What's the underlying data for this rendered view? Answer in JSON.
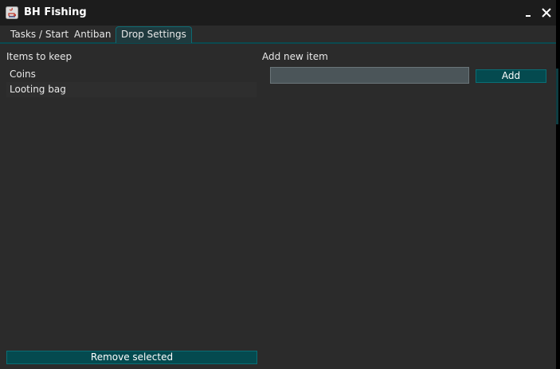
{
  "window": {
    "title": "BH Fishing",
    "icons": {
      "app": "java-app-icon",
      "minimize": "minimize-icon",
      "close": "close-icon"
    }
  },
  "tabs": [
    {
      "label": "Tasks / Start",
      "selected": false
    },
    {
      "label": "Antiban",
      "selected": false
    },
    {
      "label": "Drop Settings",
      "selected": true
    }
  ],
  "keep_panel": {
    "label": "Items to keep",
    "items": [
      "Coins",
      "Looting bag"
    ],
    "remove_button": "Remove selected"
  },
  "add_panel": {
    "label": "Add new item",
    "input_value": "",
    "add_button": "Add"
  },
  "colors": {
    "window_bg": "#2b2b2b",
    "titlebar_bg": "#1c1c1c",
    "accent_button": "#044a4f",
    "input_bg": "#4b5559"
  }
}
